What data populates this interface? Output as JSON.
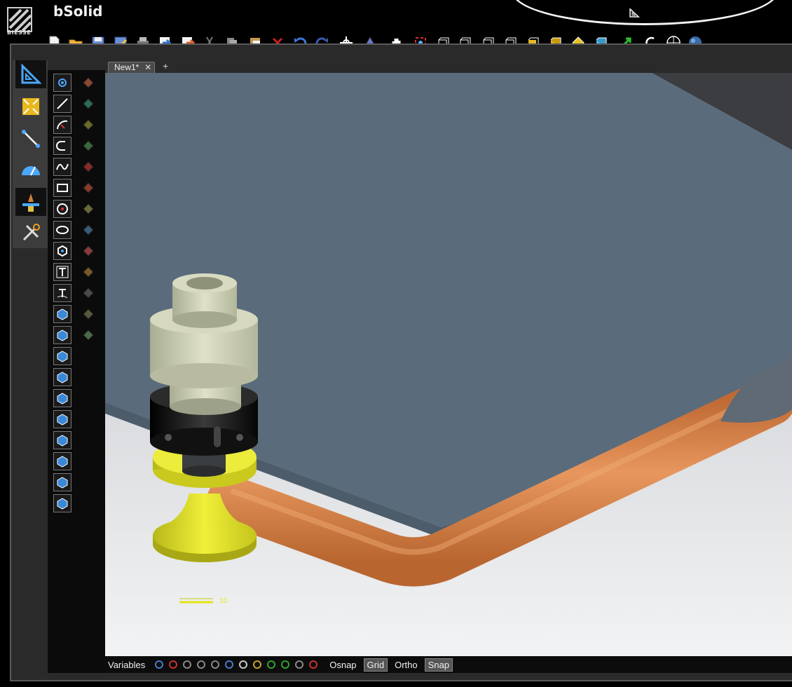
{
  "app": {
    "title": "bSolid",
    "logo_text": "BIESSE"
  },
  "toolbar": {
    "items": [
      {
        "name": "new-file-icon"
      },
      {
        "name": "open-folder-icon"
      },
      {
        "name": "save-icon"
      },
      {
        "name": "save-as-icon"
      },
      {
        "name": "print-icon"
      },
      {
        "name": "import-icon"
      },
      {
        "name": "export-icon"
      },
      {
        "name": "cut-icon"
      },
      {
        "name": "copy-icon"
      },
      {
        "name": "paste-icon"
      },
      {
        "name": "delete-icon"
      },
      {
        "name": "undo-icon"
      },
      {
        "name": "redo-icon"
      },
      {
        "name": "origin-icon"
      },
      {
        "name": "orbit-icon"
      },
      {
        "name": "pan-hand-icon"
      },
      {
        "name": "zoom-extents-icon"
      },
      {
        "name": "view-front-icon"
      },
      {
        "name": "view-back-icon"
      },
      {
        "name": "view-left-icon"
      },
      {
        "name": "view-right-icon"
      },
      {
        "name": "view-top-icon"
      },
      {
        "name": "view-iso-icon"
      },
      {
        "name": "view-bottom-icon"
      },
      {
        "name": "view-3d-icon"
      },
      {
        "name": "select-arrow-icon"
      },
      {
        "name": "rotate-view-icon"
      },
      {
        "name": "wireframe-sphere-icon"
      },
      {
        "name": "shaded-sphere-icon"
      }
    ]
  },
  "palette": {
    "items": [
      {
        "name": "drafting-icon",
        "active": true
      },
      {
        "name": "fit-view-icon",
        "active": false
      },
      {
        "name": "measure-icon",
        "active": false
      },
      {
        "name": "gauge-icon",
        "active": false
      },
      {
        "name": "machining-icon",
        "active": true
      },
      {
        "name": "tools-icon",
        "active": false
      }
    ]
  },
  "tools": {
    "column1": [
      "point-icon",
      "line-icon",
      "arc-icon",
      "slot-icon",
      "spline-icon",
      "rectangle-icon",
      "circle-icon",
      "ellipse-icon",
      "polygon-icon",
      "text-icon",
      "text-path-icon",
      "extrude-icon",
      "revolve-icon",
      "sweep-icon",
      "loft-icon",
      "box-icon",
      "cube-icon",
      "cube-options-icon",
      "sphere-icon",
      "mesh-icon",
      "import-solid-icon"
    ],
    "column2": [
      "shape1-icon",
      "shape2-icon",
      "shape3-icon",
      "shape4-icon",
      "shape5-icon",
      "shape6-icon",
      "shape7-icon",
      "shape8-icon",
      "shape9-icon",
      "shape10-icon",
      "shape11-icon",
      "shape12-icon",
      "shape13-icon"
    ]
  },
  "tab": {
    "label": "New1*",
    "close": "✕",
    "add": "+"
  },
  "viewport": {
    "scale_value": "10",
    "colors": {
      "panel": "#5a6b7c",
      "pipe": "#d9884e",
      "cup": "#e0e02a",
      "tool_body": "#c9ccb0",
      "collar": "#111111"
    }
  },
  "statusbar": {
    "variables": "Variables",
    "snap_icons": [
      "snap-endpoint-icon",
      "snap-midpoint-icon",
      "snap-intersection-icon",
      "snap-perpendicular-icon",
      "snap-tangent-icon",
      "snap-parallel-icon",
      "snap-center-icon",
      "snap-quadrant-icon",
      "snap-nearest-icon",
      "snap-node-icon",
      "snap-extension-icon",
      "snap-magnet-icon"
    ],
    "osnap": "Osnap",
    "grid": "Grid",
    "ortho": "Ortho",
    "snap": "Snap"
  }
}
